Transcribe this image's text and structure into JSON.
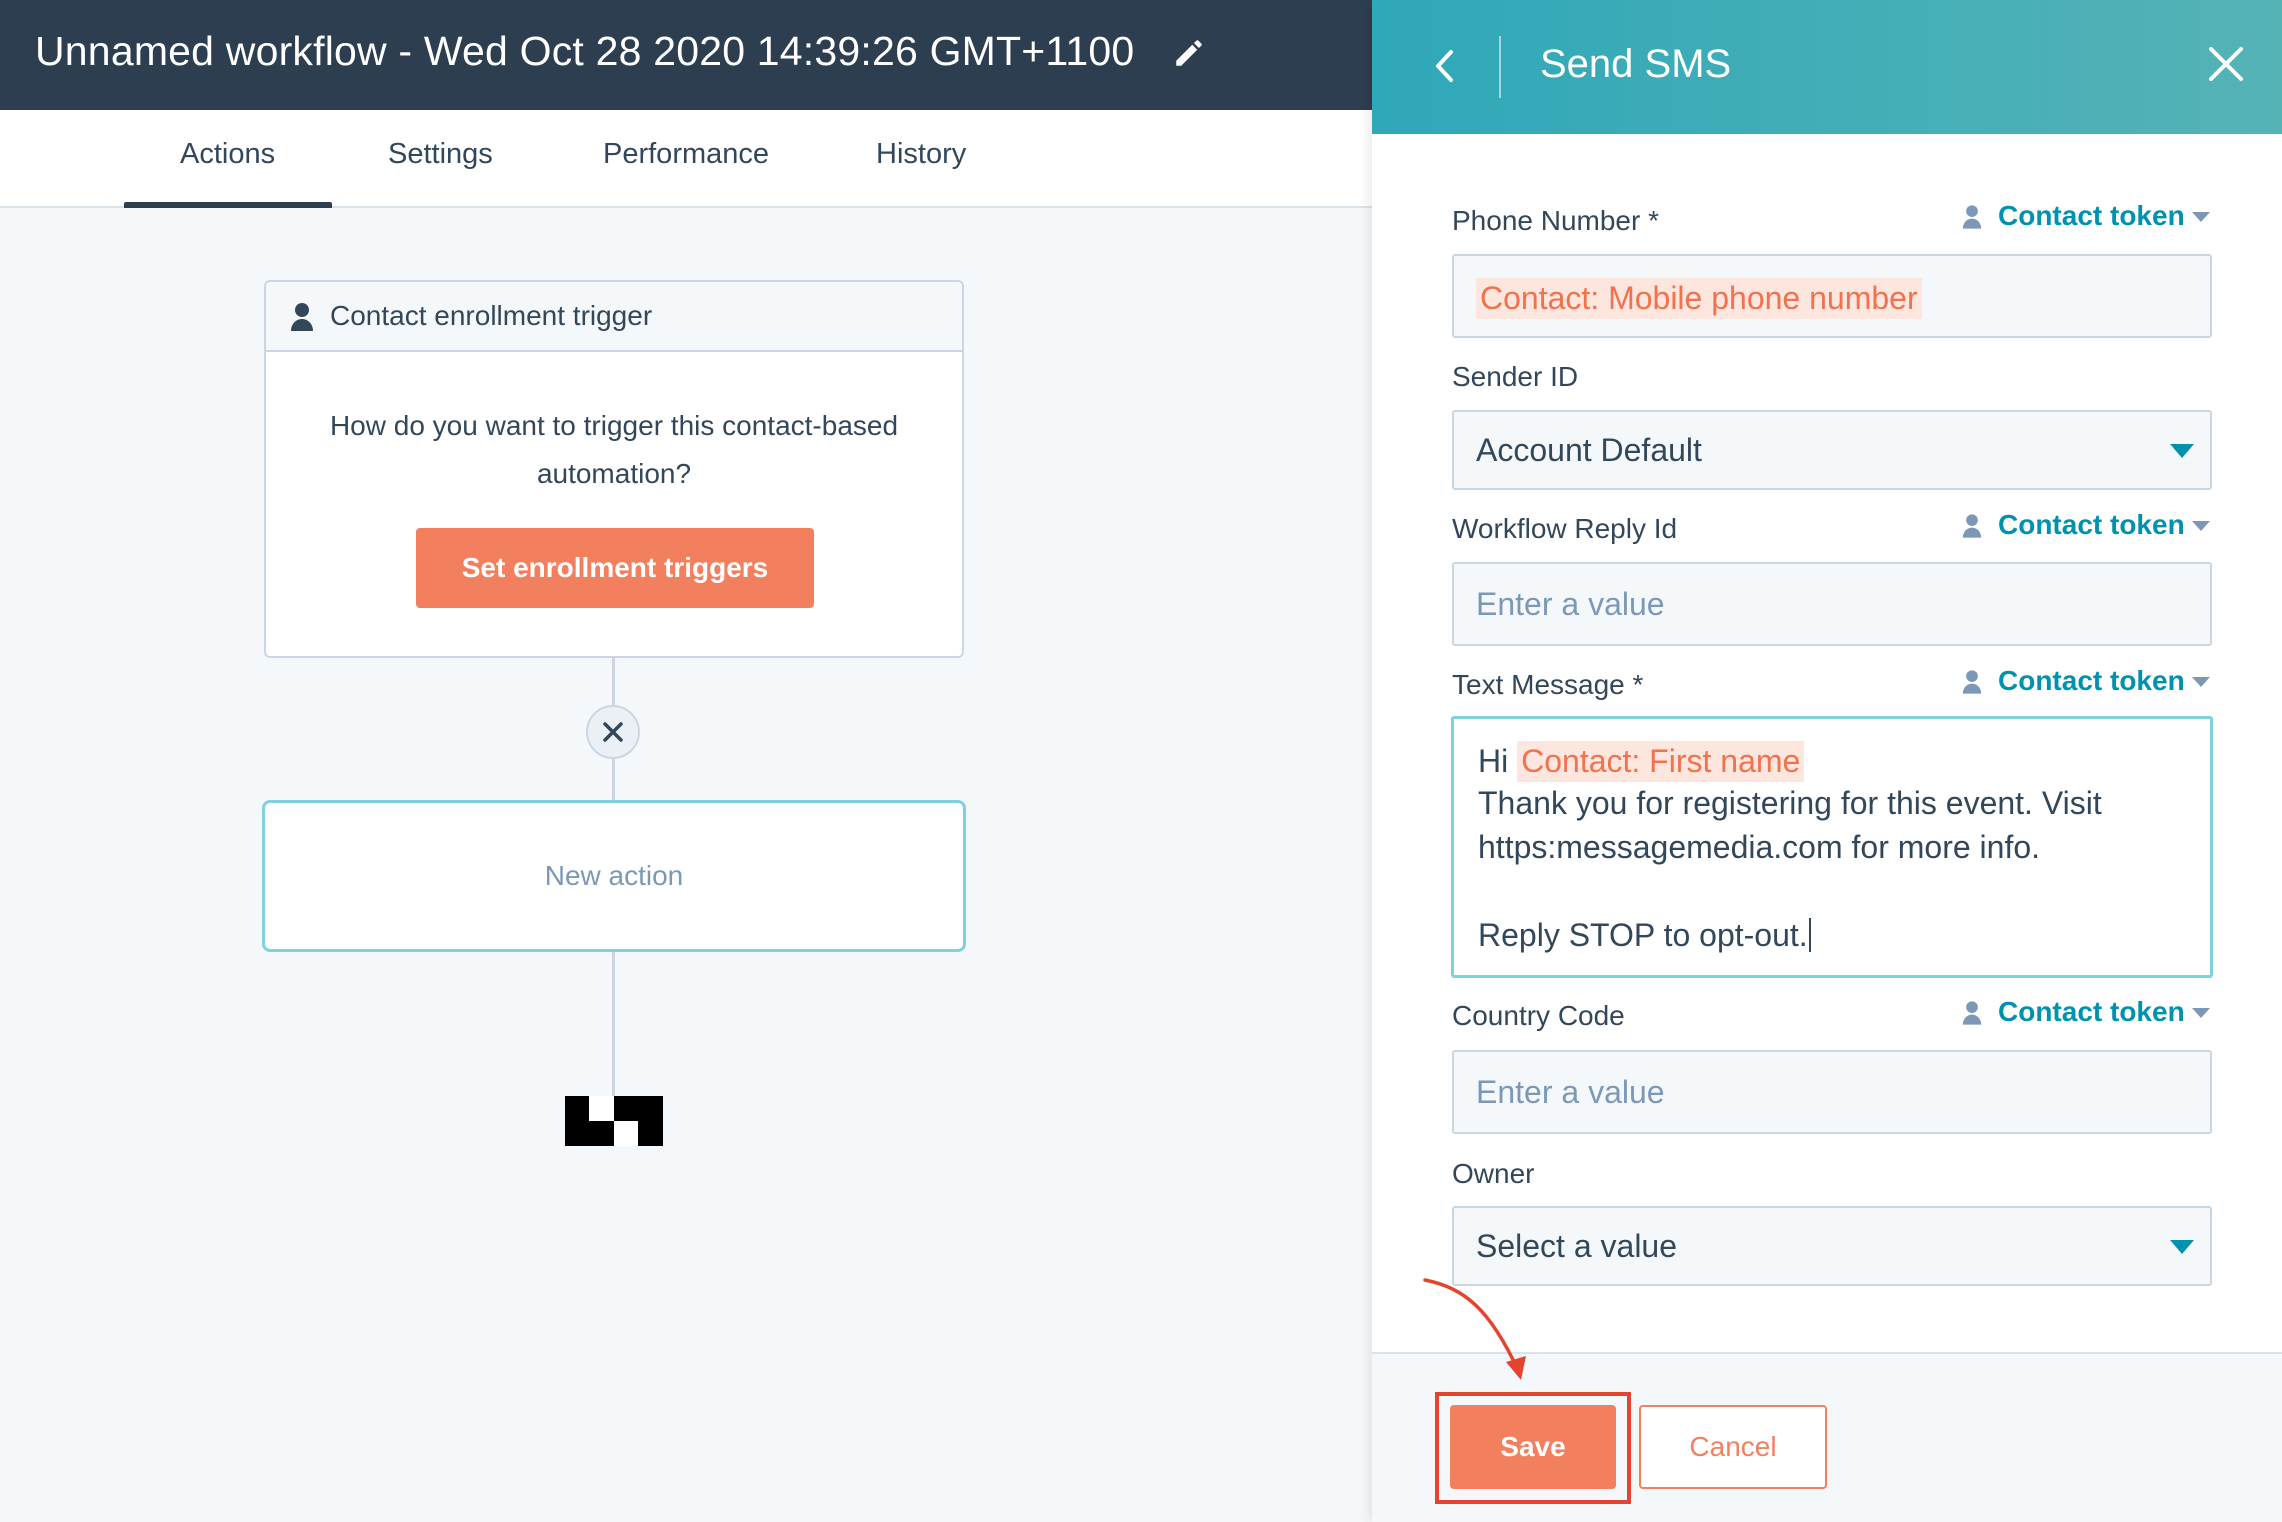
{
  "workflow": {
    "title": "Unnamed workflow - Wed Oct 28 2020 14:39:26 GMT+1100",
    "edit_icon": "pencil-icon",
    "tabs": [
      {
        "label": "Actions",
        "active": true
      },
      {
        "label": "Settings",
        "active": false
      },
      {
        "label": "Performance",
        "active": false
      },
      {
        "label": "History",
        "active": false
      }
    ],
    "trigger_card": {
      "header": "Contact enrollment trigger",
      "body": "How do you want to trigger this contact-based automation?",
      "button_label": "Set enrollment triggers"
    },
    "new_action_label": "New action",
    "end_icon": "checkered-flag-icon"
  },
  "panel": {
    "title": "Send SMS",
    "back_icon": "chevron-left-icon",
    "close_icon": "close-icon",
    "token_link_label": "Contact token",
    "fields": {
      "phone_number": {
        "label": "Phone Number *",
        "token": "Contact: Mobile phone number"
      },
      "sender_id": {
        "label": "Sender ID",
        "value": "Account Default"
      },
      "workflow_reply_id": {
        "label": "Workflow Reply Id",
        "placeholder": "Enter a value"
      },
      "text_message": {
        "label": "Text Message *",
        "greeting": "Hi",
        "token": "Contact: First name",
        "line2": "Thank you for registering for this event. Visit",
        "line3": "https:messagemedia.com for more info.",
        "line5": "Reply STOP to opt-out."
      },
      "country_code": {
        "label": "Country Code",
        "placeholder": "Enter a value"
      },
      "owner": {
        "label": "Owner",
        "value": "Select a value"
      }
    },
    "footer": {
      "save_label": "Save",
      "cancel_label": "Cancel"
    }
  },
  "colors": {
    "topbar": "#2d3e50",
    "accent_orange": "#f2805f",
    "teal": "#0091ae",
    "highlight_red": "#e4442e"
  }
}
